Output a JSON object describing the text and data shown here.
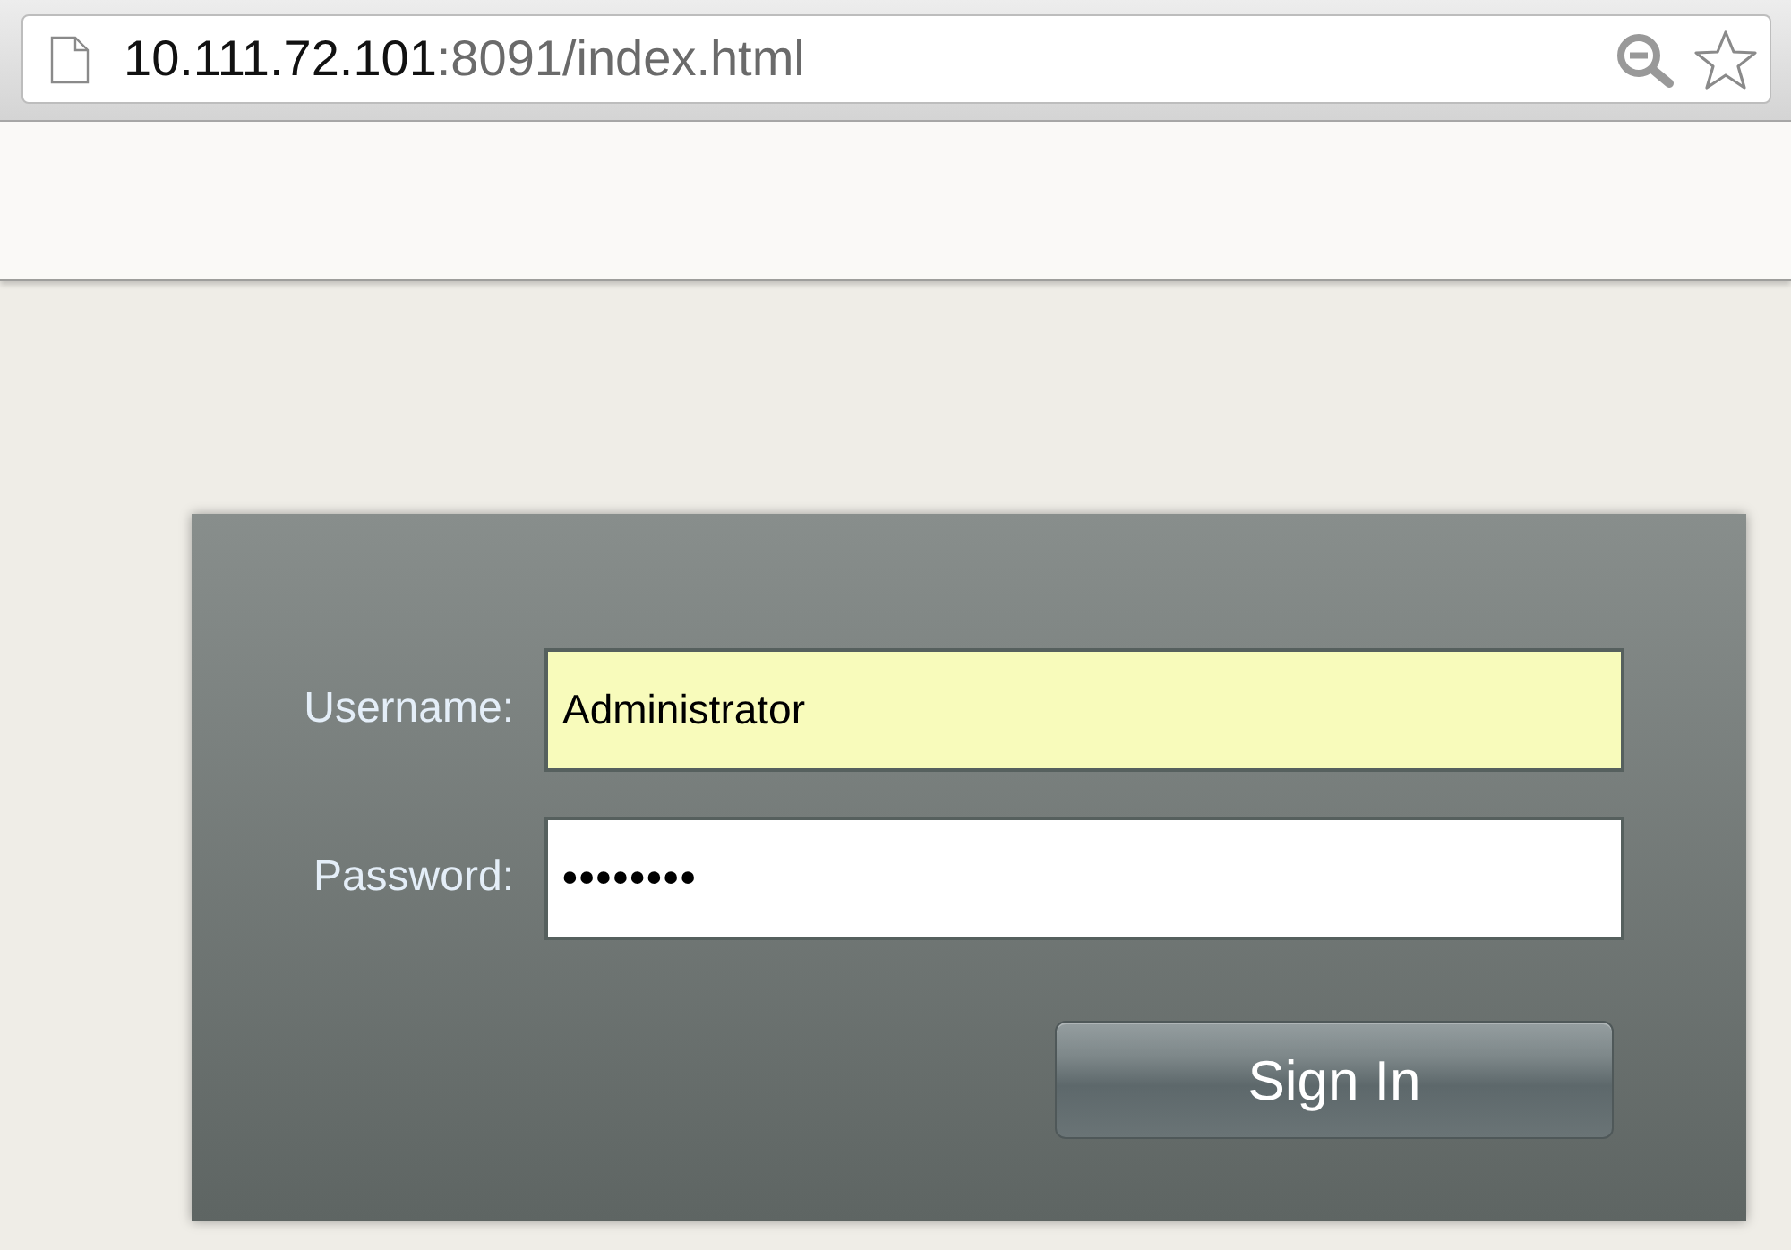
{
  "browser": {
    "address": {
      "host": "10.111.72.101",
      "path": ":8091/index.html"
    }
  },
  "login_form": {
    "fields": [
      {
        "kind": "text",
        "label": "Username:",
        "value": "Administrator",
        "autofilled": true
      },
      {
        "kind": "password",
        "label": "Password:",
        "value": "••••••••",
        "autofilled": false
      }
    ],
    "button": "Sign In"
  }
}
